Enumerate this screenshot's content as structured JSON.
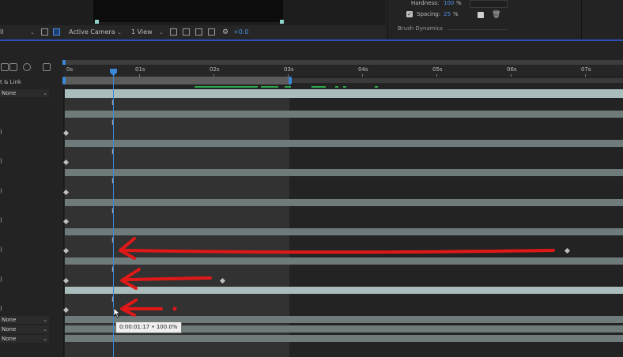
{
  "viewer": {
    "magnification_tail": "ll",
    "camera": "Active Camera",
    "view": "1 View",
    "exposure": "+0.0"
  },
  "brush": {
    "hardness_label": "Hardness:",
    "hardness_value": "100",
    "hardness_unit": "%",
    "spacing_label": "Spacing:",
    "spacing_value": "25",
    "spacing_unit": "%",
    "dynamics_label": "Brush Dynamics"
  },
  "timeline": {
    "column_header_fragment": "t & Link",
    "parent_first": "None",
    "parent_bottom": [
      "None",
      "None",
      "None"
    ],
    "ticks": [
      "0s",
      "01s",
      "02s",
      "03s",
      "04s",
      "05s",
      "06s",
      "07s"
    ],
    "row_markers": [
      ")",
      ")",
      ")",
      ")",
      ")",
      ")",
      ")"
    ],
    "tooltip": "0:00:01:17 • 100.0%"
  },
  "colors": {
    "accent_blue": "#2d4fbf",
    "cti_blue": "#3b88d8",
    "annotation_red": "#e01818",
    "layer_bar": "#6f7a7a",
    "layer_bar_light": "#a9bebc",
    "cache_green": "#2fa84a"
  },
  "icons": {
    "header": [
      "solo-icon",
      "comment-icon",
      "motion-blur-icon",
      "graph-editor-icon"
    ],
    "toolbar": [
      "channel-icon",
      "region-icon",
      "grid-icon",
      "snapshot-icon",
      "show-snapshot-icon",
      "color-icon"
    ]
  }
}
